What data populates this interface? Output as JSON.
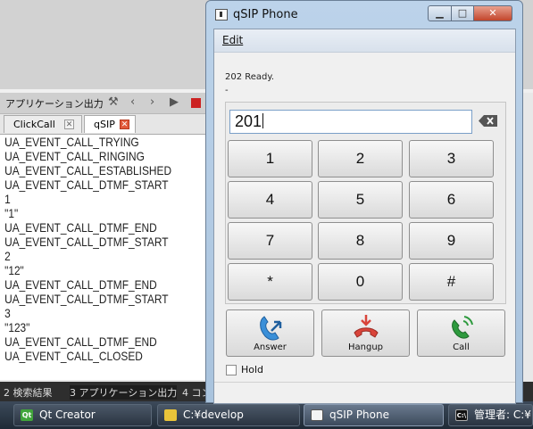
{
  "qt_creator": {
    "output_pane_title": "アプリケーション出力",
    "tabs": [
      {
        "label": "ClickCall"
      },
      {
        "label": "qSIP"
      }
    ],
    "output_lines": [
      "UA_EVENT_CALL_TRYING",
      "UA_EVENT_CALL_RINGING",
      "UA_EVENT_CALL_ESTABLISHED",
      "UA_EVENT_CALL_DTMF_START",
      "1",
      "\"1\"",
      "UA_EVENT_CALL_DTMF_END",
      "UA_EVENT_CALL_DTMF_START",
      "2",
      "\"12\"",
      "UA_EVENT_CALL_DTMF_END",
      "UA_EVENT_CALL_DTMF_START",
      "3",
      "\"123\"",
      "UA_EVENT_CALL_DTMF_END",
      "UA_EVENT_CALL_CLOSED"
    ],
    "bottom_tabs": [
      "2 検索結果",
      "3 アプリケーション出力",
      "4 コン"
    ]
  },
  "taskbar": {
    "items": [
      {
        "label": "Qt Creator",
        "icon": "qt-icon"
      },
      {
        "label": "C:¥develop",
        "icon": "folder-icon"
      },
      {
        "label": "qSIP Phone",
        "icon": "app-icon"
      },
      {
        "label": "管理者: C:¥",
        "icon": "console-icon"
      }
    ]
  },
  "qsip": {
    "title": "qSIP Phone",
    "menu": {
      "edit": "Edit"
    },
    "status_line1": "202 Ready.",
    "status_line2": "-",
    "dial_value": "201",
    "keys": [
      "1",
      "2",
      "3",
      "4",
      "5",
      "6",
      "7",
      "8",
      "9",
      "*",
      "0",
      "#"
    ],
    "actions": {
      "answer": "Answer",
      "hangup": "Hangup",
      "call": "Call"
    },
    "hold_label": "Hold",
    "hold_checked": false,
    "colors": {
      "answer": "#3a8fd8",
      "hangup": "#d9443a",
      "call": "#2e9a3e"
    }
  }
}
